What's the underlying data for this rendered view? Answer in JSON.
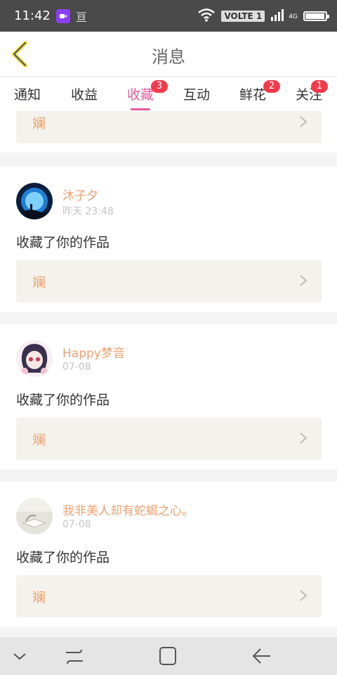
{
  "statusbar": {
    "time": "11:42",
    "extra_glyph": "亘",
    "volte_label": "VOLTE 1",
    "network_label": "4G",
    "battery_level": 0.95
  },
  "header": {
    "title": "消息"
  },
  "tabs": [
    {
      "label": "通知",
      "badge": ""
    },
    {
      "label": "收益",
      "badge": ""
    },
    {
      "label": "收藏",
      "badge": "3",
      "active": true
    },
    {
      "label": "互动",
      "badge": ""
    },
    {
      "label": "鲜花",
      "badge": "2"
    },
    {
      "label": "关注",
      "badge": "1"
    }
  ],
  "feed": {
    "top_partial_work_title": "斓",
    "items": [
      {
        "username": "沐子夕",
        "time": "昨天 23:48",
        "action": "收藏了你的作品",
        "work_title": "斓",
        "avatar": "avatar-moon"
      },
      {
        "username": "Happy梦音",
        "time": "07-08",
        "action": "收藏了你的作品",
        "work_title": "斓",
        "avatar": "avatar-anime-girl"
      },
      {
        "username": "我非美人却有蛇蝎之心。",
        "time": "07-08",
        "action": "收藏了你的作品",
        "work_title": "斓",
        "avatar": "avatar-book"
      }
    ]
  },
  "colors": {
    "accent_pink": "#e55b9e",
    "badge_red": "#f13b4d",
    "username_orange": "#f0a070",
    "card_bg": "#f4f2ec"
  },
  "icons": {
    "back": "chevron-left-icon",
    "nav": [
      "chevron-down-icon",
      "recents-icon",
      "home-icon",
      "back-arrow-icon"
    ]
  }
}
